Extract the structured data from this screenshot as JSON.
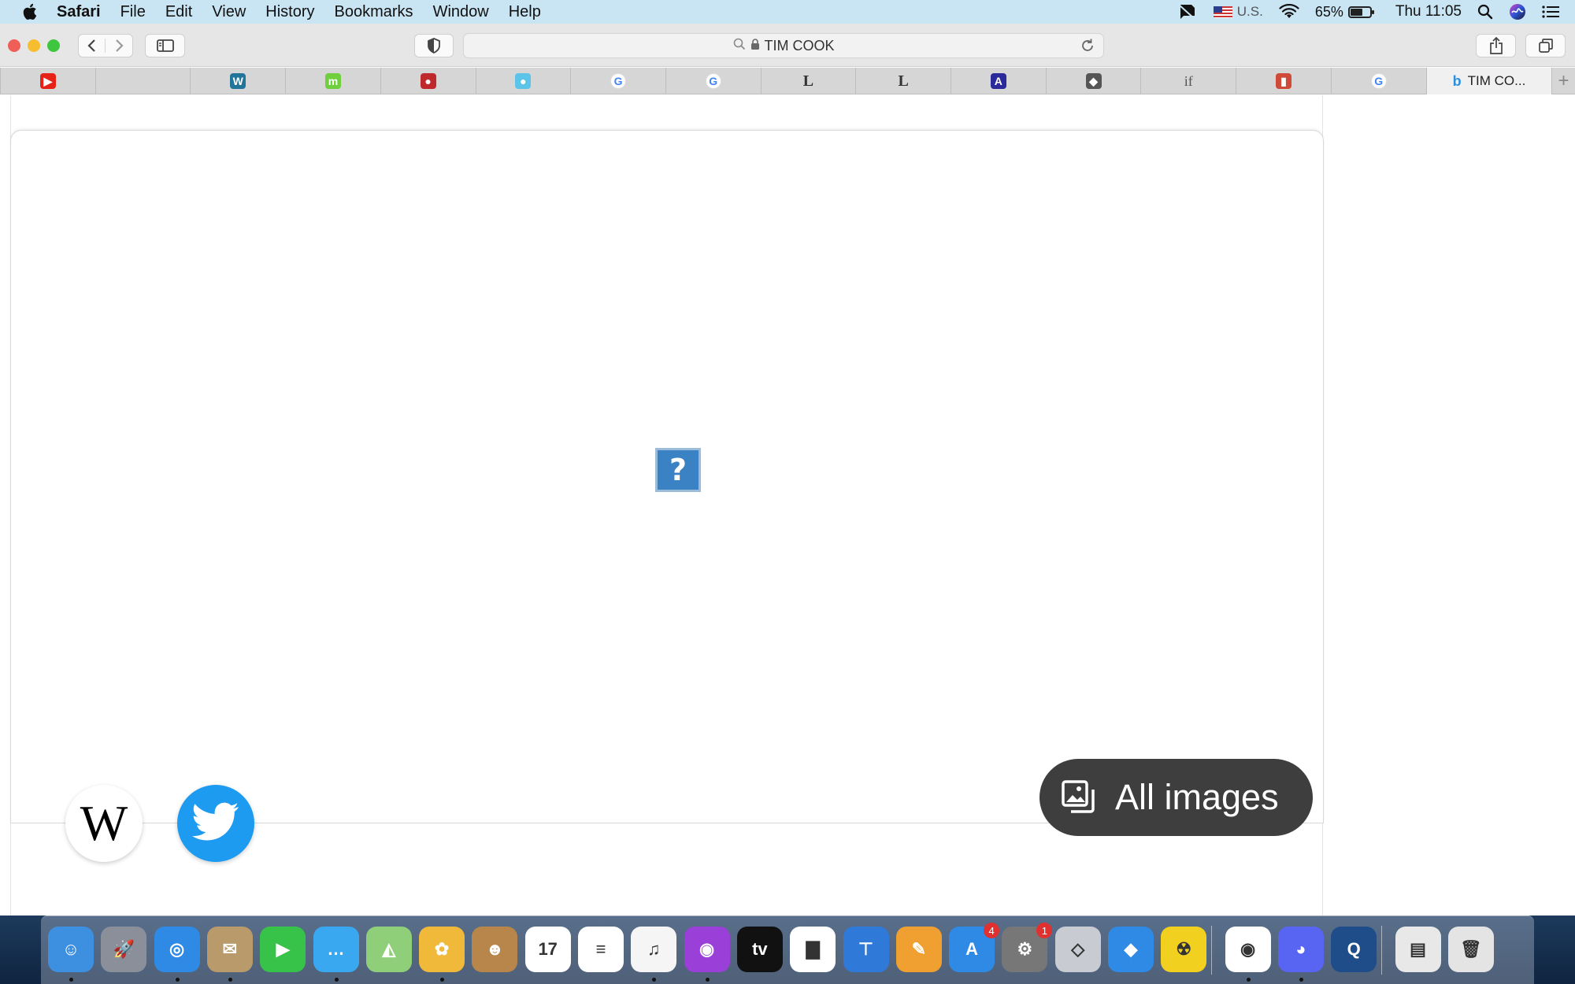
{
  "menubar": {
    "app_name": "Safari",
    "items": [
      "File",
      "Edit",
      "View",
      "History",
      "Bookmarks",
      "Window",
      "Help"
    ],
    "input_source": "U.S.",
    "battery_percent": "65%",
    "battery_level": 0.65,
    "clock": "Thu 11:05"
  },
  "toolbar": {
    "address_text": "TIM COOK",
    "traffic_colors": [
      "#ee5f57",
      "#f6be2f",
      "#3ec63f"
    ]
  },
  "tabs": {
    "active_label": "TIM CO...",
    "items": [
      {
        "icon": "youtube-icon",
        "color": "#e62117",
        "glyph": "▶"
      },
      {
        "icon": "blank-tab-icon",
        "color": "transparent",
        "glyph": ""
      },
      {
        "icon": "wordpress-icon",
        "color": "#21759b",
        "glyph": "W"
      },
      {
        "icon": "mathsgenie-icon",
        "color": "#6fcf3c",
        "glyph": "m"
      },
      {
        "icon": "apple-red-icon",
        "color": "#c0292b",
        "glyph": "●"
      },
      {
        "icon": "globe-icon",
        "color": "#5bc4e8",
        "glyph": "●"
      },
      {
        "icon": "google-icon",
        "color": "#ffffff",
        "glyph": "G"
      },
      {
        "icon": "google-icon",
        "color": "#ffffff",
        "glyph": "G"
      },
      {
        "icon": "letter-l-icon",
        "color": "transparent",
        "glyph": "L"
      },
      {
        "icon": "letter-l-icon",
        "color": "transparent",
        "glyph": "L"
      },
      {
        "icon": "airbit-icon",
        "color": "#2a2a9a",
        "glyph": "A"
      },
      {
        "icon": "roblox-icon",
        "color": "#555555",
        "glyph": "◆"
      },
      {
        "icon": "if-icon",
        "color": "transparent",
        "glyph": "if"
      },
      {
        "icon": "phone-icon",
        "color": "#d04a3a",
        "glyph": "▮"
      },
      {
        "icon": "google-icon",
        "color": "#ffffff",
        "glyph": "G"
      }
    ]
  },
  "page": {
    "all_images_label": "All images",
    "broken_image_glyph": "?",
    "wiki_glyph": "W"
  },
  "dock": {
    "badges": {
      "app_store": "4",
      "system_preferences": "1"
    },
    "apps": [
      {
        "icon": "finder-icon",
        "color": "#3d8fe0",
        "glyph": "☺",
        "running": true
      },
      {
        "icon": "launchpad-icon",
        "color": "#8a8f99",
        "glyph": "🚀",
        "running": false
      },
      {
        "icon": "safari-icon",
        "color": "#2f8ae6",
        "glyph": "◎",
        "running": true
      },
      {
        "icon": "mail-stamp-icon",
        "color": "#b99a6a",
        "glyph": "✉",
        "running": true
      },
      {
        "icon": "facetime-icon",
        "color": "#37c24a",
        "glyph": "▶",
        "running": false
      },
      {
        "icon": "messages-icon",
        "color": "#3aa8f0",
        "glyph": "…",
        "running": true
      },
      {
        "icon": "maps-icon",
        "color": "#8fcf7a",
        "glyph": "◭",
        "running": false
      },
      {
        "icon": "photos-icon",
        "color": "#f0b93a",
        "glyph": "✿",
        "running": true
      },
      {
        "icon": "contacts-icon",
        "color": "#b8864a",
        "glyph": "☻",
        "running": false
      },
      {
        "icon": "calendar-icon",
        "color": "#ffffff",
        "glyph": "17",
        "running": false
      },
      {
        "icon": "reminders-icon",
        "color": "#ffffff",
        "glyph": "≡",
        "running": false
      },
      {
        "icon": "music-icon",
        "color": "#f5f5f5",
        "glyph": "♫",
        "running": true
      },
      {
        "icon": "podcasts-icon",
        "color": "#9a3fd8",
        "glyph": "◉",
        "running": true
      },
      {
        "icon": "apple-tv-icon",
        "color": "#111111",
        "glyph": "tv",
        "running": false
      },
      {
        "icon": "numbers-icon",
        "color": "#ffffff",
        "glyph": "▇",
        "running": false
      },
      {
        "icon": "keynote-icon",
        "color": "#2f7ad9",
        "glyph": "⊤",
        "running": false
      },
      {
        "icon": "pages-icon",
        "color": "#f0a030",
        "glyph": "✎",
        "running": false
      },
      {
        "icon": "app-store-icon",
        "color": "#2f8ae6",
        "glyph": "A",
        "running": false
      },
      {
        "icon": "system-preferences-icon",
        "color": "#777777",
        "glyph": "⚙",
        "running": false
      },
      {
        "icon": "roblox-studio-icon",
        "color": "#c8ccd2",
        "glyph": "◇",
        "running": false
      },
      {
        "icon": "roblox-icon",
        "color": "#2f8ae6",
        "glyph": "◆",
        "running": false
      },
      {
        "icon": "nuclear-icon",
        "color": "#f2d020",
        "glyph": "☢",
        "running": false
      },
      {
        "icon": "chrome-icon",
        "color": "#ffffff",
        "glyph": "◉",
        "running": true
      },
      {
        "icon": "discord-icon",
        "color": "#5865f2",
        "glyph": "◕",
        "running": true
      },
      {
        "icon": "quicktime-icon",
        "color": "#1f4d8a",
        "glyph": "Q",
        "running": false
      },
      {
        "icon": "preview-image-icon",
        "color": "#e8e8e8",
        "glyph": "▤",
        "running": false
      },
      {
        "icon": "trash-icon",
        "color": "#e4e4e4",
        "glyph": "🗑",
        "running": false
      }
    ]
  }
}
